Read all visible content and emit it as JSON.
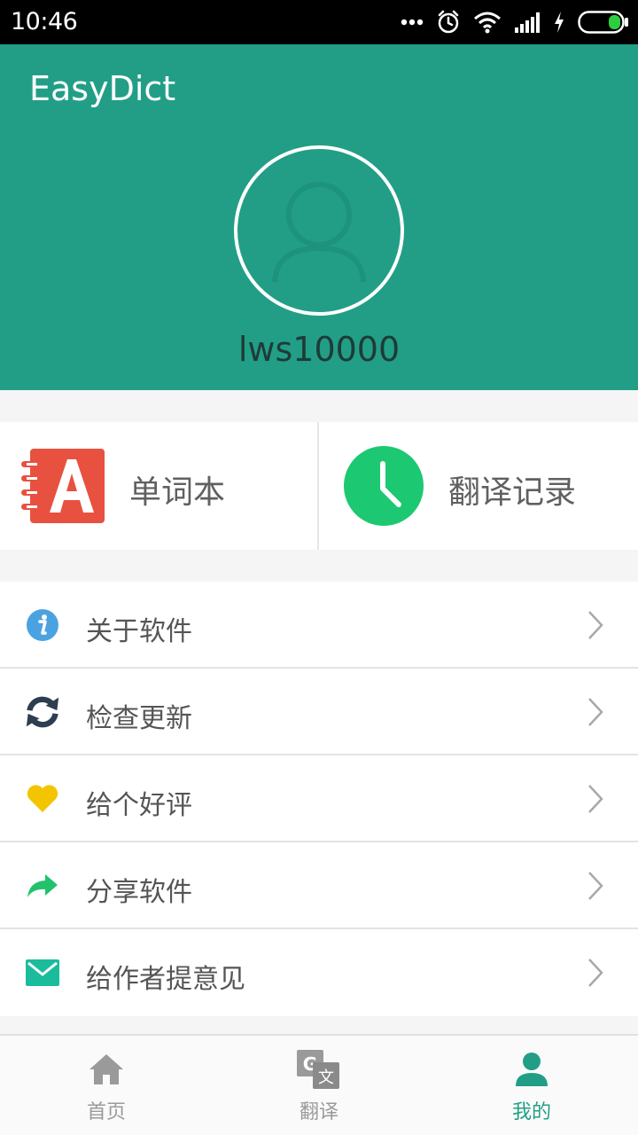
{
  "status_bar": {
    "time": "10:46",
    "icons": [
      "more-dots-icon",
      "alarm-icon",
      "wifi-icon",
      "signal-icon",
      "charging-icon",
      "battery-icon"
    ]
  },
  "header": {
    "app_title": "EasyDict",
    "username": "lws10000",
    "background_color": "#229e87"
  },
  "quick_actions": [
    {
      "label": "单词本",
      "icon": "wordbook-icon",
      "color": "#e8513f"
    },
    {
      "label": "翻译记录",
      "icon": "clock-icon",
      "color": "#1dc873"
    }
  ],
  "menu": {
    "items": [
      {
        "label": "关于软件",
        "icon": "info-icon",
        "color": "#4aa3e0"
      },
      {
        "label": "检查更新",
        "icon": "refresh-icon",
        "color": "#2c3e50"
      },
      {
        "label": "给个好评",
        "icon": "heart-icon",
        "color": "#f2c500"
      },
      {
        "label": "分享软件",
        "icon": "share-icon",
        "color": "#22c26b"
      },
      {
        "label": "给作者提意见",
        "icon": "mail-icon",
        "color": "#1abc9c"
      }
    ]
  },
  "bottom_nav": {
    "tabs": [
      {
        "label": "首页",
        "icon": "home-icon"
      },
      {
        "label": "翻译",
        "icon": "translate-icon"
      },
      {
        "label": "我的",
        "icon": "profile-icon"
      }
    ],
    "active_tab": "我的",
    "active_color": "#229e87",
    "inactive_color": "#9a9a9a"
  }
}
